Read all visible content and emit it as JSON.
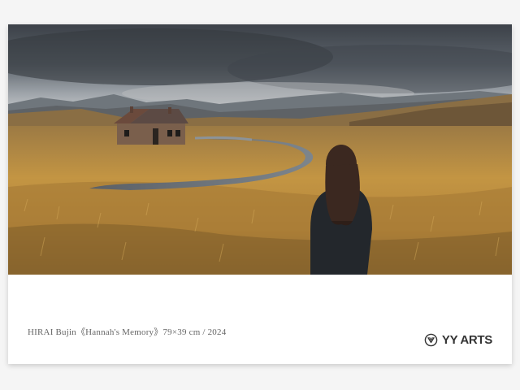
{
  "artwork": {
    "caption": "HIRAI Bujin《Hannah's Memory》79×39 cm / 2024",
    "subject": "woman-standing-in-golden-meadow-facing-abandoned-house"
  },
  "brand": {
    "name": "YY ARTS",
    "icon": "yy-arts-logo-icon"
  },
  "colors": {
    "sky": "#5a6068",
    "meadow": "#b98a3c",
    "card": "#ffffff",
    "caption_text": "#666666",
    "brand_text": "#333333"
  }
}
